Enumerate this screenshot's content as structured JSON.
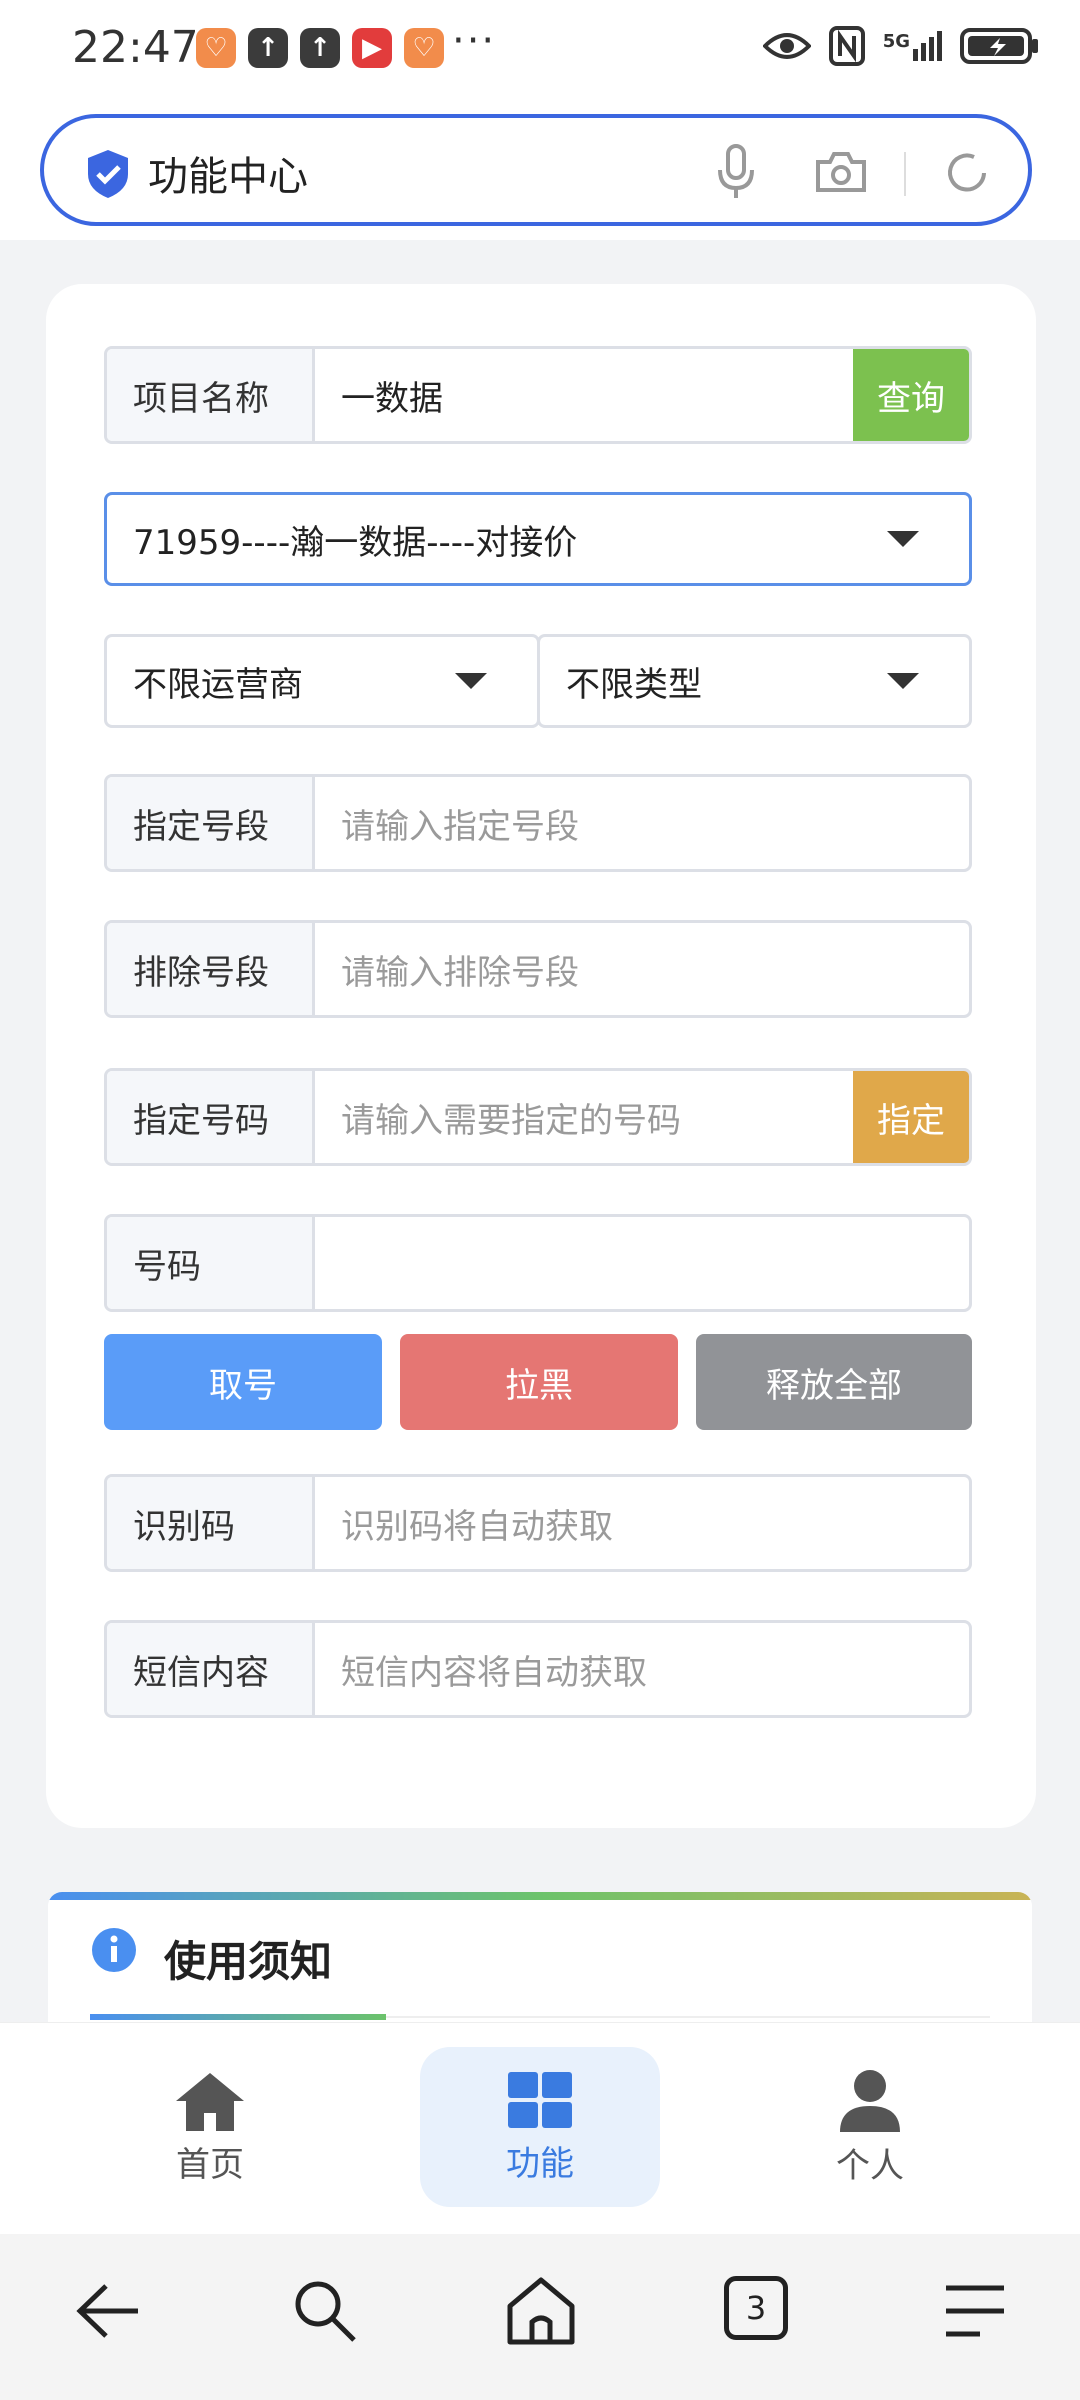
{
  "status_bar": {
    "time": "22:47",
    "more": "···",
    "network": "5G"
  },
  "search_bar": {
    "title": "功能中心"
  },
  "form": {
    "project_name": {
      "label": "项目名称",
      "value": "一数据",
      "button": "查询"
    },
    "project_select": {
      "value": "71959----瀚一数据----对接价"
    },
    "operator_select": {
      "value": "不限运营商"
    },
    "type_select": {
      "value": "不限类型"
    },
    "prefix_include": {
      "label": "指定号段",
      "placeholder": "请输入指定号段"
    },
    "prefix_exclude": {
      "label": "排除号段",
      "placeholder": "请输入排除号段"
    },
    "specify_number": {
      "label": "指定号码",
      "placeholder": "请输入需要指定的号码",
      "button": "指定"
    },
    "number": {
      "label": "号码",
      "value": ""
    },
    "actions": {
      "get": "取号",
      "blacklist": "拉黑",
      "release_all": "释放全部"
    },
    "code": {
      "label": "识别码",
      "placeholder": "识别码将自动获取"
    },
    "sms": {
      "label": "短信内容",
      "placeholder": "短信内容将自动获取"
    }
  },
  "notice": {
    "title": "使用须知"
  },
  "bottom_nav": {
    "items": [
      {
        "label": "首页",
        "icon": "home-icon"
      },
      {
        "label": "功能",
        "icon": "grid-icon",
        "active": true
      },
      {
        "label": "个人",
        "icon": "user-icon"
      }
    ]
  },
  "system_nav": {
    "tab_count": "3"
  },
  "colors": {
    "accent": "#3b66e0",
    "query_button": "#7cc14f",
    "specify_button": "#e0a84a",
    "get_button": "#5a9cf8",
    "blacklist_button": "#e57673",
    "release_button": "#919397"
  }
}
